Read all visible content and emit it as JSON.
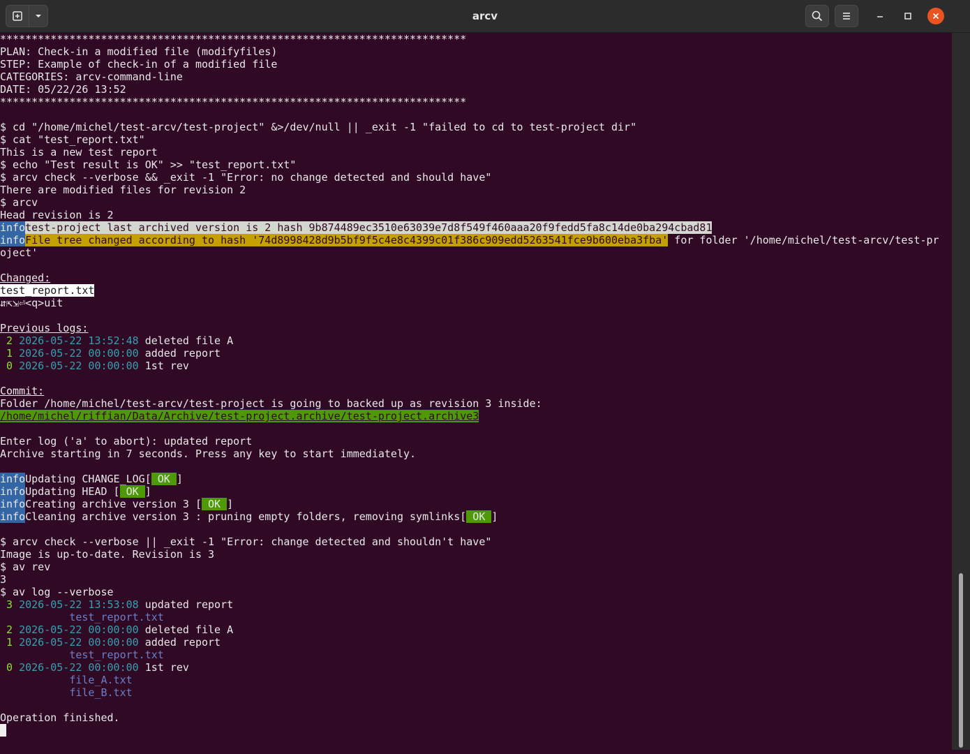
{
  "window": {
    "title": "arcv"
  },
  "icons": {
    "new_tab": "new-tab-icon",
    "tab_menu": "chevron-down-icon",
    "search": "search-icon",
    "menu": "hamburger-menu-icon",
    "minimize": "minimize-icon",
    "maximize": "maximize-icon",
    "close": "close-icon"
  },
  "colors": {
    "terminal_bg": "#300a24",
    "info_badge": "#3465a4",
    "ok_badge": "#4e9a06",
    "hash_highlight": "#c4a000",
    "close_button": "#e95420"
  },
  "terminal": {
    "stars": "**************************************************************************",
    "plan": "PLAN: Check-in a modified file (modifyfiles)",
    "step": "STEP: Example of check-in of a modified file",
    "categories": "CATEGORIES: arcv-command-line",
    "date": "DATE: 05/22/26 13:52",
    "cmd_cd": "$ cd \"/home/michel/test-arcv/test-project\" &>/dev/null || _exit -1 \"failed to cd to test-project dir\"",
    "cmd_cat": "$ cat \"test_report.txt\"",
    "out_cat": "This is a new test report",
    "cmd_echo": "$ echo \"Test result is OK\" >> \"test_report.txt\"",
    "cmd_check1": "$ arcv check --verbose && _exit -1 \"Error: no change detected and should have\"",
    "out_check1": "There are modified files for revision 2",
    "cmd_arcv": "$ arcv",
    "out_head": "Head revision is 2",
    "info_label": "info",
    "info1": "test-project last archived version is 2 hash 9b874489ec3510e63039e7d8f549f460aaa20f9fedd5fa8c14de0ba294cbad81",
    "info2_hl": "File tree changed according to hash '74d8998428d9b5bf9f5c4e8c4399c01f386c909edd5263541fce9b600eba3fba'",
    "info2_rest": " for folder '/home/michel/test-arcv/test-pr",
    "info2_wrap": "oject'",
    "changed_label": "Changed:",
    "changed_file": "test_report.txt",
    "nav_keys": "⇵⇱⇲⏎<q>uit",
    "prev_logs_label": "Previous logs:",
    "prev_logs": [
      {
        "num": "2",
        "date": "2026-05-22 13:52:48",
        "msg": "deleted file A"
      },
      {
        "num": "1",
        "date": "2026-05-22 00:00:00",
        "msg": "added report"
      },
      {
        "num": "0",
        "date": "2026-05-22 00:00:00",
        "msg": "1st rev"
      }
    ],
    "commit_label": "Commit:",
    "commit_folder": "Folder /home/michel/test-arcv/test-project is going to backed up as revision 3 inside:",
    "commit_path": "/home/michel/riffian/Data/Archive/test-project.archive/test-project.archive3",
    "enter_log": "Enter log ('a' to abort): updated report",
    "archive_start": "Archive starting in 7 seconds. Press any key to start immediately.",
    "ok_label": " OK ",
    "status": [
      {
        "text": "Updating CHANGE_LOG[",
        "after": "]"
      },
      {
        "text": "Updating HEAD [",
        "after": "]"
      },
      {
        "text": "Creating archive version 3 [",
        "after": "]"
      },
      {
        "text": "Cleaning archive version 3 : pruning empty folders, removing symlinks[",
        "after": "]"
      }
    ],
    "cmd_check2": "$ arcv check --verbose || _exit -1 \"Error: change detected and shouldn't have\"",
    "out_check2": "Image is up-to-date. Revision is 3",
    "cmd_rev": "$ av rev",
    "out_rev": "3",
    "cmd_log": "$ av log --verbose",
    "log": [
      {
        "num": "3",
        "date": "2026-05-22 13:53:08",
        "msg": "updated report",
        "files": [
          "test_report.txt"
        ]
      },
      {
        "num": "2",
        "date": "2026-05-22 00:00:00",
        "msg": "deleted file A",
        "files": []
      },
      {
        "num": "1",
        "date": "2026-05-22 00:00:00",
        "msg": "added report",
        "files": [
          "test_report.txt"
        ]
      },
      {
        "num": "0",
        "date": "2026-05-22 00:00:00",
        "msg": "1st rev",
        "files": [
          "file_A.txt",
          "file_B.txt"
        ]
      }
    ],
    "finished": "Operation finished."
  }
}
